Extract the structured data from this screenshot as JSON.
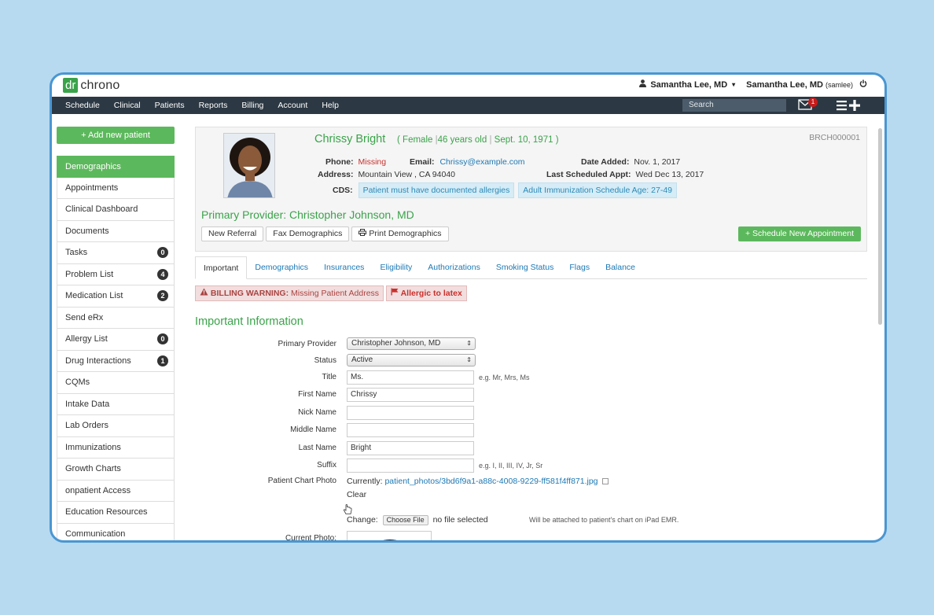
{
  "app": {
    "logo_dr": "dr",
    "logo_chrono": "chrono",
    "user_menu": "Samantha Lee, MD",
    "user_account": "Samantha Lee, MD",
    "user_handle": "(samlee)"
  },
  "nav": {
    "items": [
      "Schedule",
      "Clinical",
      "Patients",
      "Reports",
      "Billing",
      "Account",
      "Help"
    ],
    "search_placeholder": "Search",
    "mail_count": "1"
  },
  "sidebar": {
    "add_button": "+ Add new patient",
    "items": [
      {
        "label": "Demographics",
        "count": ""
      },
      {
        "label": "Appointments",
        "count": ""
      },
      {
        "label": "Clinical Dashboard",
        "count": ""
      },
      {
        "label": "Documents",
        "count": ""
      },
      {
        "label": "Tasks",
        "count": "0"
      },
      {
        "label": "Problem List",
        "count": "4"
      },
      {
        "label": "Medication List",
        "count": "2"
      },
      {
        "label": "Send eRx",
        "count": ""
      },
      {
        "label": "Allergy List",
        "count": "0"
      },
      {
        "label": "Drug Interactions",
        "count": "1"
      },
      {
        "label": "CQMs",
        "count": ""
      },
      {
        "label": "Intake Data",
        "count": ""
      },
      {
        "label": "Lab Orders",
        "count": ""
      },
      {
        "label": "Immunizations",
        "count": ""
      },
      {
        "label": "Growth Charts",
        "count": ""
      },
      {
        "label": "onpatient Access",
        "count": ""
      },
      {
        "label": "Education Resources",
        "count": ""
      },
      {
        "label": "Communication",
        "count": ""
      }
    ]
  },
  "patient": {
    "name": "Chrissy Bright",
    "paren_open": "(",
    "gender": "Female",
    "age": "46 years old",
    "dob": "Sept. 10, 1971",
    "paren_close": ")",
    "sep": "|",
    "id": "BRCH000001",
    "phone_label": "Phone:",
    "phone_value": "Missing",
    "email_label": "Email:",
    "email_value": "Chrissy@example.com",
    "date_added_label": "Date Added:",
    "date_added_value": "Nov. 1, 2017",
    "address_label": "Address:",
    "address_value": "Mountain View , CA 94040",
    "last_appt_label": "Last Scheduled Appt:",
    "last_appt_value": "Wed Dec 13, 2017",
    "cds_label": "CDS:",
    "cds_items": [
      "Patient must have documented allergies",
      "Adult Immunization Schedule Age: 27-49"
    ],
    "primary_provider": "Primary Provider: Christopher Johnson, MD"
  },
  "actions": {
    "new_referral": "New Referral",
    "fax": "Fax Demographics",
    "print": "Print Demographics",
    "schedule": "+ Schedule New Appointment"
  },
  "tabs": [
    "Important",
    "Demographics",
    "Insurances",
    "Eligibility",
    "Authorizations",
    "Smoking Status",
    "Flags",
    "Balance"
  ],
  "alerts": {
    "billing_strong": "BILLING WARNING:",
    "billing_text": "Missing Patient Address",
    "allergy": "Allergic to latex"
  },
  "form": {
    "title": "Important Information",
    "primary_provider_label": "Primary Provider",
    "primary_provider_value": "Christopher Johnson, MD",
    "status_label": "Status",
    "status_value": "Active",
    "title_label": "Title",
    "title_value": "Ms.",
    "title_hint": "e.g. Mr, Mrs, Ms",
    "first_name_label": "First Name",
    "first_name_value": "Chrissy",
    "nick_name_label": "Nick Name",
    "nick_name_value": "",
    "middle_name_label": "Middle Name",
    "middle_name_value": "",
    "last_name_label": "Last Name",
    "last_name_value": "Bright",
    "suffix_label": "Suffix",
    "suffix_value": "",
    "suffix_hint": "e.g. I, II, III, IV, Jr, Sr",
    "chart_photo_label": "Patient Chart Photo",
    "currently_label": "Currently:",
    "currently_link": "patient_photos/3bd6f9a1-a88c-4008-9229-ff581f4ff871.jpg",
    "clear_label": "Clear",
    "change_label": "Change:",
    "choose_file": "Choose File",
    "no_file": "no file selected",
    "attach_note": "Will be attached to patient's chart on iPad EMR.",
    "current_photo_label": "Current Photo:"
  },
  "colors": {
    "accent_green": "#5cb85c",
    "nav_dark": "#2c3843",
    "link_blue": "#1e78b3",
    "frame_border": "#4a96d2",
    "background": "#b7daf0"
  }
}
